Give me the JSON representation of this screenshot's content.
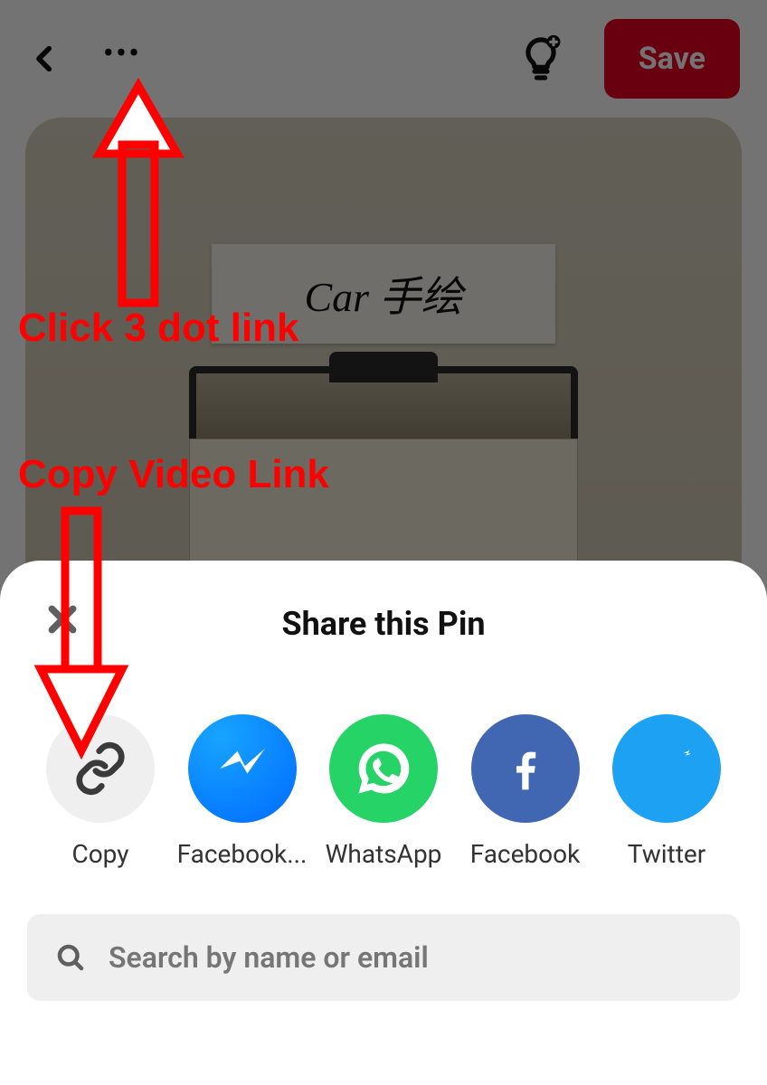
{
  "topbar": {
    "save_label": "Save"
  },
  "pin": {
    "caption": "Car 手绘"
  },
  "sheet": {
    "title": "Share this Pin",
    "search_placeholder": "Search by name or email",
    "options": {
      "copy": "Copy",
      "messenger": "Facebook...",
      "whatsapp": "WhatsApp",
      "facebook": "Facebook",
      "twitter": "Twitter"
    }
  },
  "annotations": {
    "step1": "Click 3 dot link",
    "step2": "Copy Video Link"
  }
}
